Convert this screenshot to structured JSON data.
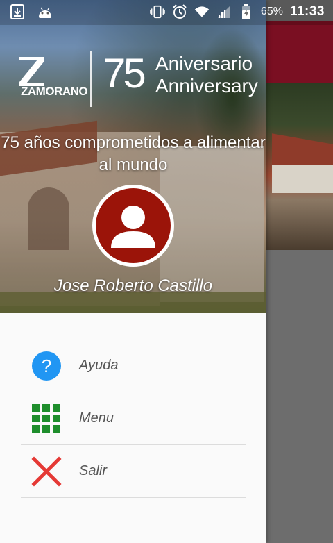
{
  "status_bar": {
    "battery_percent": "65%",
    "time": "11:33",
    "icons_left": [
      "download-icon",
      "android-icon"
    ],
    "icons_right": [
      "vibrate-icon",
      "alarm-icon",
      "wifi-icon",
      "signal-icon",
      "battery-icon"
    ]
  },
  "drawer": {
    "logo": {
      "brand": "ZAMORANO",
      "number": "75",
      "line1": "Aniversario",
      "line2": "Anniversary"
    },
    "tagline": "75 años comprometidos a alimentar al mundo",
    "user": {
      "name": "Jose Roberto Castillo",
      "avatar_icon": "person-icon"
    },
    "menu": [
      {
        "label": "Ayuda",
        "icon": "help-icon",
        "color": "#2196f3"
      },
      {
        "label": "Menu",
        "icon": "grid-icon",
        "color": "#1e8e2c"
      },
      {
        "label": "Salir",
        "icon": "close-icon",
        "color": "#e53935"
      }
    ]
  },
  "colors": {
    "app_bar": "#7a0f22",
    "avatar_bg": "#9b1409",
    "drawer_bg": "#fafafa",
    "scrim": "#6d6d6d"
  }
}
